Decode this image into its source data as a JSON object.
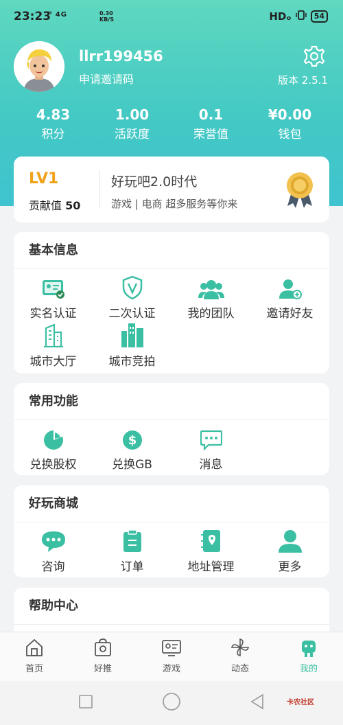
{
  "status": {
    "time": "23:23",
    "signal": "ᴴ 4G",
    "net_speed": "0.30",
    "net_unit": "KB/S",
    "hd": "HDₒ",
    "battery": "54"
  },
  "profile": {
    "username": "llrr199456",
    "invite_link": "申请邀请码",
    "version": "版本 2.5.1"
  },
  "stats": [
    {
      "value": "4.83",
      "label": "积分"
    },
    {
      "value": "1.00",
      "label": "活跃度"
    },
    {
      "value": "0.1",
      "label": "荣誉值"
    },
    {
      "value": "¥0.00",
      "label": "钱包"
    }
  ],
  "level": {
    "lv": "LV1",
    "contrib_label": "贡献值",
    "contrib_value": "50",
    "title": "好玩吧2.0时代",
    "subtitle": "游戏 | 电商 超多服务等你来"
  },
  "basic": {
    "title": "基本信息",
    "items": [
      {
        "label": "实名认证",
        "icon": "id-card-verified-icon"
      },
      {
        "label": "二次认证",
        "icon": "shield-v-icon"
      },
      {
        "label": "我的团队",
        "icon": "team-icon"
      },
      {
        "label": "邀请好友",
        "icon": "add-friend-icon"
      },
      {
        "label": "城市大厅",
        "icon": "building-icon"
      },
      {
        "label": "城市竞拍",
        "icon": "city-bid-icon"
      }
    ]
  },
  "common": {
    "title": "常用功能",
    "items": [
      {
        "label": "兑换股权",
        "icon": "pie-icon"
      },
      {
        "label": "兑换GB",
        "icon": "dollar-icon"
      },
      {
        "label": "消息",
        "icon": "chat-icon"
      }
    ]
  },
  "mall": {
    "title": "好玩商城",
    "items": [
      {
        "label": "咨询",
        "icon": "consult-icon"
      },
      {
        "label": "订单",
        "icon": "clipboard-icon"
      },
      {
        "label": "地址管理",
        "icon": "address-book-icon"
      },
      {
        "label": "更多",
        "icon": "user-more-icon"
      }
    ]
  },
  "help": {
    "title": "帮助中心"
  },
  "tabs": [
    {
      "label": "首页",
      "icon": "home-icon"
    },
    {
      "label": "好推",
      "icon": "bag-icon"
    },
    {
      "label": "游戏",
      "icon": "game-card-icon"
    },
    {
      "label": "动态",
      "icon": "pinwheel-icon"
    },
    {
      "label": "我的",
      "icon": "robot-icon"
    }
  ],
  "colors": {
    "accent": "#3bbfa2",
    "gold": "#f0a21a"
  },
  "watermark": "卡农社区"
}
